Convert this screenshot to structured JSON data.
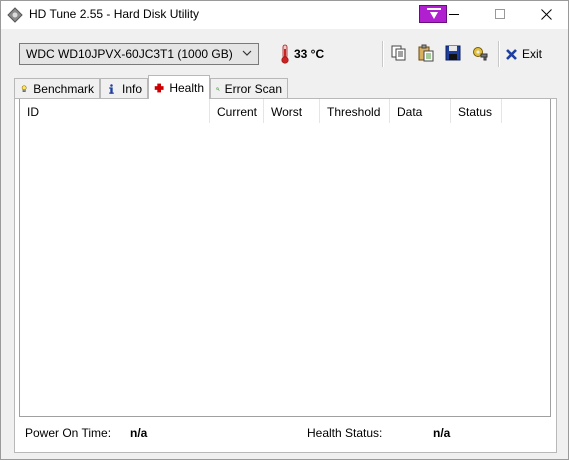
{
  "window": {
    "title": "HD Tune 2.55 - Hard Disk Utility"
  },
  "toolbar": {
    "drive": "WDC    WD10JPVX-60JC3T1 (1000 GB)",
    "temperature": "33 °C",
    "exit_label": "Exit"
  },
  "tabs": [
    {
      "label": "Benchmark",
      "icon": "lightbulb-icon"
    },
    {
      "label": "Info",
      "icon": "info-icon"
    },
    {
      "label": "Health",
      "icon": "red-cross-icon",
      "active": true
    },
    {
      "label": "Error Scan",
      "icon": "magnifier-icon"
    }
  ],
  "health": {
    "columns": [
      "ID",
      "Current",
      "Worst",
      "Threshold",
      "Data",
      "Status"
    ],
    "rows": [],
    "power_on_label": "Power On Time:",
    "power_on_value": "n/a",
    "status_label": "Health Status:",
    "status_value": "n/a"
  },
  "colors": {
    "accent_purple": "#b020d0",
    "health_cross": "#cc0000",
    "thermometer": "#cc2222"
  }
}
